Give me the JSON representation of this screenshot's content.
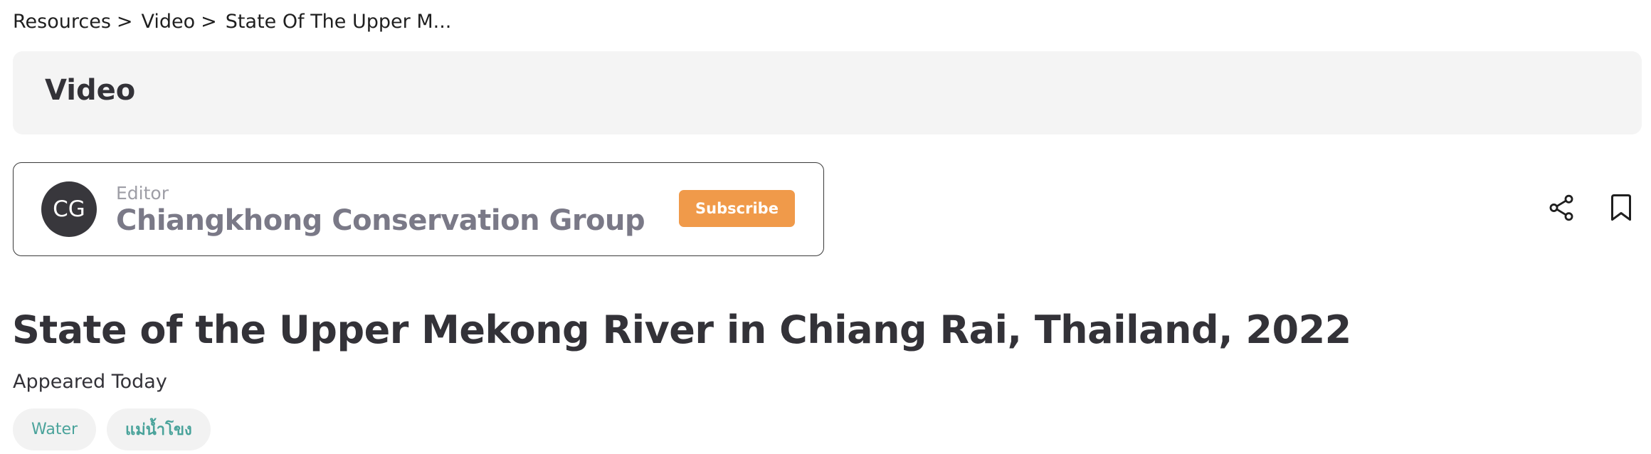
{
  "breadcrumb": {
    "items": [
      "Resources",
      "Video"
    ],
    "separator": ">",
    "current": "State Of The Upper M..."
  },
  "section": {
    "title": "Video"
  },
  "editor": {
    "initials": "CG",
    "role": "Editor",
    "name": "Chiangkhong Conservation Group",
    "subscribe_label": "Subscribe"
  },
  "actions": {
    "share_icon": "share-icon",
    "bookmark_icon": "bookmark-icon"
  },
  "article": {
    "title": "State of the Upper Mekong River in Chiang Rai, Thailand, 2022",
    "appeared": "Appeared Today",
    "tags": [
      "Water",
      "แม่น้ำโขง"
    ]
  },
  "colors": {
    "subscribe_bg": "#f09a4a",
    "tag_text": "#4aa39b",
    "avatar_bg": "#38373c",
    "section_bg": "#f4f4f4"
  }
}
